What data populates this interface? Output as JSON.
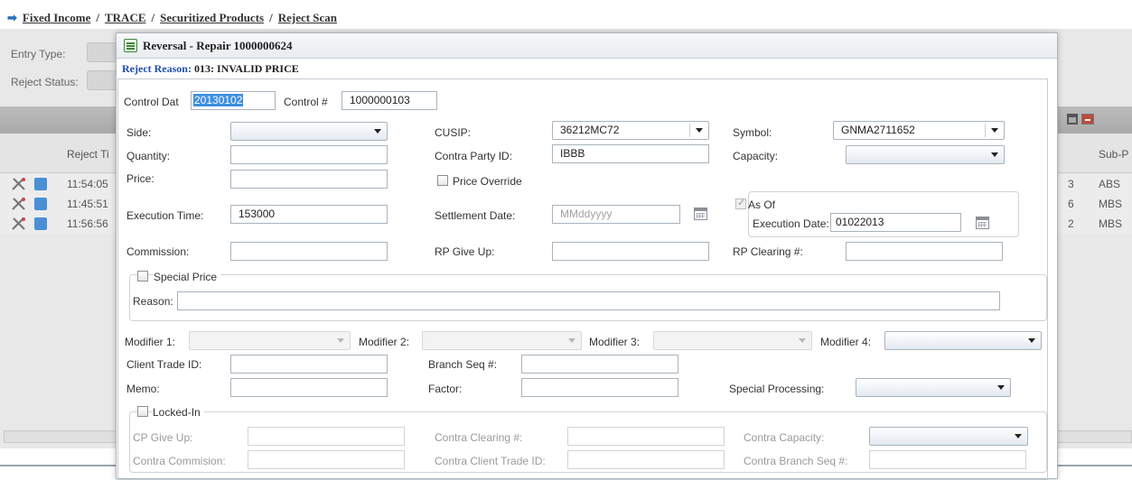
{
  "breadcrumb": [
    "Fixed Income",
    "TRACE",
    "Securitized Products",
    "Reject Scan"
  ],
  "background": {
    "entry_type_label": "Entry Type:",
    "reject_status_label": "Reject Status:",
    "reject_time_header": "Reject Ti",
    "sub_header": "Sub-P",
    "rows": [
      {
        "time": "11:54:05",
        "right_num": "3",
        "sub": "ABS"
      },
      {
        "time": "11:45:51",
        "right_num": "6",
        "sub": "MBS"
      },
      {
        "time": "11:56:56",
        "right_num": "2",
        "sub": "MBS"
      }
    ]
  },
  "dialog": {
    "title": "Reversal - Repair 1000000624",
    "reject_reason_label": "Reject Reason:",
    "reject_reason_value": "013: INVALID PRICE",
    "control_date_label": "Control Dat",
    "control_date_value": "20130102",
    "control_num_label": "Control #",
    "control_num_value": "1000000103",
    "side_label": "Side:",
    "side_value": "",
    "cusip_label": "CUSIP:",
    "cusip_value": "36212MC72",
    "symbol_label": "Symbol:",
    "symbol_value": "GNMA2711652",
    "quantity_label": "Quantity:",
    "quantity_value": "",
    "contra_party_label": "Contra Party ID:",
    "contra_party_value": "IBBB",
    "capacity_label": "Capacity:",
    "capacity_value": "",
    "price_label": "Price:",
    "price_value": "",
    "price_override_label": "Price Override",
    "as_of_label": "As Of",
    "execution_time_label": "Execution Time:",
    "execution_time_value": "153000",
    "settlement_date_label": "Settlement Date:",
    "settlement_date_placeholder": "MMddyyyy",
    "execution_date_label": "Execution Date:",
    "execution_date_value": "01022013",
    "commission_label": "Commission:",
    "rp_give_up_label": "RP Give Up:",
    "rp_clearing_label": "RP Clearing #:",
    "special_price_label": "Special Price",
    "reason_label": "Reason:",
    "modifier1_label": "Modifier 1:",
    "modifier2_label": "Modifier 2:",
    "modifier3_label": "Modifier 3:",
    "modifier4_label": "Modifier 4:",
    "client_trade_id_label": "Client Trade ID:",
    "branch_seq_label": "Branch Seq #:",
    "memo_label": "Memo:",
    "factor_label": "Factor:",
    "special_processing_label": "Special Processing:",
    "locked_in_label": "Locked-In",
    "cp_give_up_label": "CP Give Up:",
    "contra_clearing_label": "Contra Clearing #:",
    "contra_capacity_label": "Contra Capacity:",
    "contra_commission_label": "Contra Commision:",
    "contra_client_trade_id_label": "Contra Client Trade ID:",
    "contra_branch_seq_label": "Contra Branch Seq #:"
  },
  "colors": {
    "reject_reason_label": "#1f4fb0",
    "selection_highlight": "#3e8fdf",
    "background_gray": "#e8e8e8"
  }
}
